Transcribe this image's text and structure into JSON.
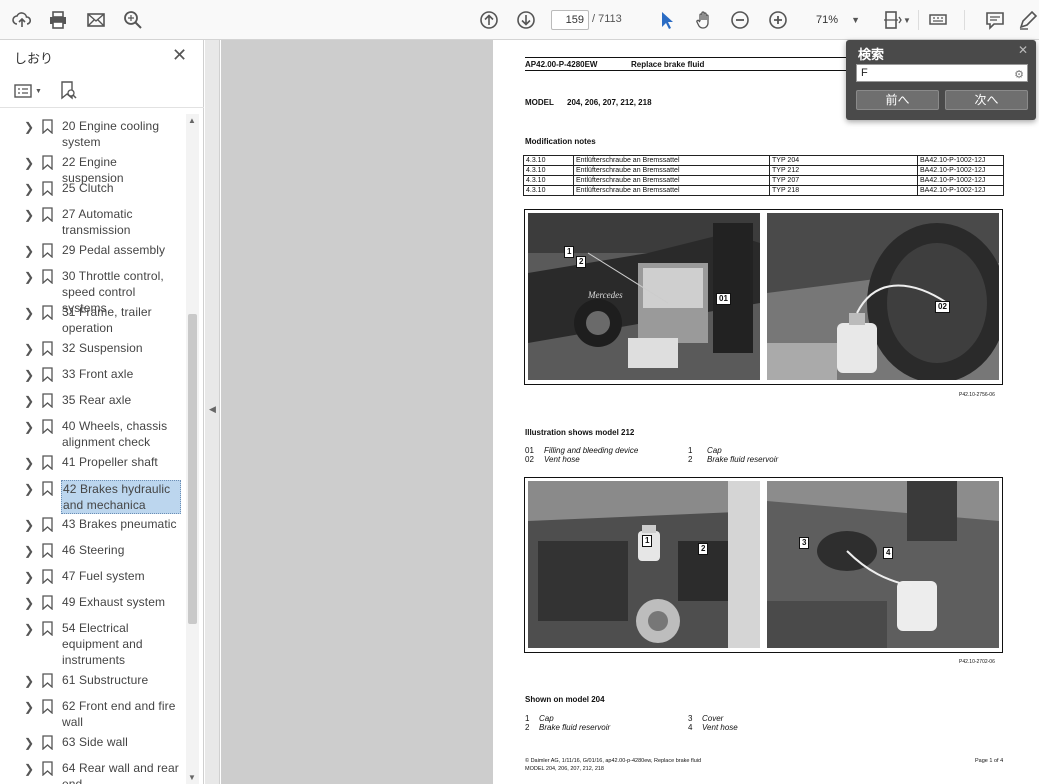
{
  "toolbar": {
    "page_current": "159",
    "page_total": "/ 7113",
    "zoom": "71%"
  },
  "sidebar": {
    "title": "しおり",
    "bookmarks": [
      {
        "label": "20 Engine cooling system"
      },
      {
        "label": "22 Engine suspension"
      },
      {
        "label": "25 Clutch"
      },
      {
        "label": "27 Automatic transmission"
      },
      {
        "label": "29 Pedal assembly"
      },
      {
        "label": "30 Throttle control, speed control systems"
      },
      {
        "label": "31 Frame, trailer operation"
      },
      {
        "label": "32 Suspension"
      },
      {
        "label": "33 Front axle"
      },
      {
        "label": "35 Rear axle"
      },
      {
        "label": "40 Wheels, chassis alignment check"
      },
      {
        "label": "41 Propeller shaft"
      },
      {
        "label": "42 Brakes hydraulic and mechanica"
      },
      {
        "label": "43 Brakes pneumatic"
      },
      {
        "label": "46 Steering"
      },
      {
        "label": "47 Fuel system"
      },
      {
        "label": "49 Exhaust system"
      },
      {
        "label": "54 Electrical equipment and instruments"
      },
      {
        "label": "61 Substructure"
      },
      {
        "label": "62 Front end and fire wall"
      },
      {
        "label": "63 Side wall"
      },
      {
        "label": "64 Rear wall and rear end"
      }
    ]
  },
  "document": {
    "doc_id": "AP42.00-P-4280EW",
    "doc_title": "Replace brake fluid",
    "model_label": "MODEL",
    "model_values": "204, 206, 207, 212, 218",
    "mod_notes_heading": "Modification notes",
    "mod_rows": [
      [
        "4.3.10",
        "Entlüfterschraube an Bremssattel",
        "TYP 204",
        "BA42.10-P-1002-12J"
      ],
      [
        "4.3.10",
        "Entlüfterschraube an Bremssattel",
        "TYP 212",
        "BA42.10-P-1002-12J"
      ],
      [
        "4.3.10",
        "Entlüfterschraube an Bremssattel",
        "TYP 207",
        "BA42.10-P-1002-12J"
      ],
      [
        "4.3.10",
        "Entlüfterschraube an Bremssattel",
        "TYP 218",
        "BA42.10-P-1002-12J"
      ]
    ],
    "photo1_id": "P42.10-2756-06",
    "fig1_caption": "Illustration shows model 212",
    "fig1_legend": [
      {
        "num": "01",
        "text": "Filling and bleeding device"
      },
      {
        "num": "02",
        "text": "Vent hose"
      },
      {
        "num": "1",
        "text": "Cap"
      },
      {
        "num": "2",
        "text": "Brake fluid reservoir"
      }
    ],
    "photo2_id": "P42.10-2702-06",
    "fig2_caption": "Shown on model 204",
    "fig2_legend": [
      {
        "num": "1",
        "text": "Cap"
      },
      {
        "num": "2",
        "text": "Brake fluid reservoir"
      },
      {
        "num": "3",
        "text": "Cover"
      },
      {
        "num": "4",
        "text": "Vent hose"
      }
    ],
    "footer_left_1": "© Daimler AG, 1/11/16, G/01/16, ap42.00-p-4280ew, Replace brake fluid",
    "footer_left_2": "MODEL 204, 206, 207, 212, 218",
    "footer_right": "Page 1 of 4",
    "callouts": {
      "c1": "1",
      "c2": "2",
      "c01": "01",
      "c02": "02",
      "d1": "1",
      "d2": "2",
      "d3": "3",
      "d4": "4"
    }
  },
  "search": {
    "title": "検索",
    "value": "F",
    "prev_label": "前へ",
    "next_label": "次へ"
  }
}
